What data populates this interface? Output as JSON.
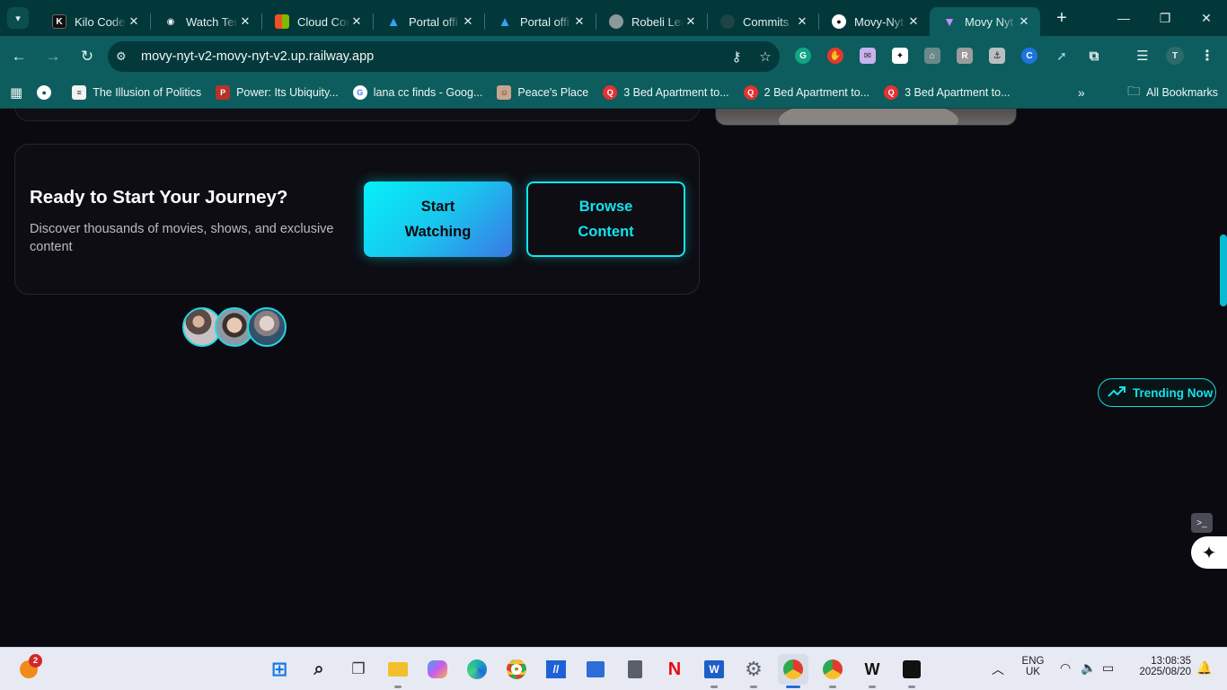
{
  "browser": {
    "tabs": [
      {
        "title": "Kilo Code",
        "favicon": "kilo-code-icon",
        "color": "#1a1a1a"
      },
      {
        "title": "Watch Ter",
        "favicon": "watch-icon",
        "color": "#ffffff"
      },
      {
        "title": "Cloud Cor",
        "favicon": "microsoft-icon",
        "color": "#f25022"
      },
      {
        "title": "Portal offi",
        "favicon": "azure-icon",
        "color": "#2f8fe8"
      },
      {
        "title": "Portal offi",
        "favicon": "azure-icon",
        "color": "#2f8fe8"
      },
      {
        "title": "Robeli Lea",
        "favicon": "globe-icon",
        "color": "#9aa7a8"
      },
      {
        "title": "Commits",
        "favicon": "github-icon",
        "color": "#173a3b"
      },
      {
        "title": "Movy-Nyt",
        "favicon": "github-icon",
        "color": "#ffffff"
      },
      {
        "title": "Movy Nyt",
        "favicon": "vite-icon",
        "color": "#b46cff"
      }
    ],
    "active_tab_index": 8,
    "url": "movy-nyt-v2-movy-nyt-v2.up.railway.app",
    "profile_initial": "T",
    "bookmarks": [
      {
        "label": "The Illusion of Politics",
        "icon": "document-icon"
      },
      {
        "label": "Power: Its Ubiquity...",
        "icon": "book-icon"
      },
      {
        "label": "lana cc finds - Goog...",
        "icon": "google-icon"
      },
      {
        "label": "Peace's Place",
        "icon": "image-icon"
      },
      {
        "label": "3 Bed Apartment to...",
        "icon": "property-icon"
      },
      {
        "label": "2 Bed Apartment to...",
        "icon": "property-icon"
      },
      {
        "label": "3 Bed Apartment to...",
        "icon": "property-icon"
      }
    ],
    "all_bookmarks_label": "All Bookmarks"
  },
  "page": {
    "cta": {
      "heading": "Ready to Start Your Journey?",
      "subtext": "Discover thousands of movies, shows, and exclusive content",
      "primary_button": "Start Watching",
      "secondary_button": "Browse Content"
    },
    "trending_label": "Trending Now",
    "accent_color": "#10e6ef"
  },
  "taskbar": {
    "notification_count": "2",
    "language_line1": "ENG",
    "language_line2": "UK",
    "time": "13:08:35",
    "date": "2025/08/20"
  }
}
